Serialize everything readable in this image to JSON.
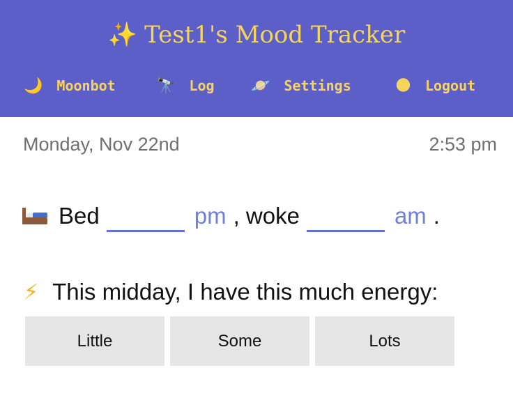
{
  "header": {
    "title": "Test1's Mood Tracker",
    "title_icon": "✨",
    "background_color": "#5b5fc7",
    "accent_color": "#f6d55c",
    "nav": [
      {
        "label": "Moonbot",
        "icon": "🌙",
        "icon_name": "crescent-moon-icon"
      },
      {
        "label": "Log",
        "icon": "🔭",
        "icon_name": "telescope-icon"
      },
      {
        "label": "Settings",
        "icon": "🪐",
        "icon_name": "ringed-planet-icon"
      },
      {
        "label": "Logout",
        "icon": "🌑",
        "icon_name": "new-moon-icon"
      }
    ]
  },
  "datebar": {
    "date": "Monday, Nov 22nd",
    "time": "2:53 pm"
  },
  "sleep": {
    "icon_name": "bed-icon",
    "bed_label": "Bed",
    "bed_value": "",
    "bed_ampm": "pm",
    "woke_label": ", woke",
    "woke_value": "",
    "woke_ampm": "am",
    "end_punct": ".",
    "link_color": "#6f7fe0"
  },
  "energy": {
    "icon": "⚡",
    "icon_name": "lightning-bolt-icon",
    "question": "This midday, I have this much energy:",
    "options": [
      "Little",
      "Some",
      "Lots"
    ]
  }
}
